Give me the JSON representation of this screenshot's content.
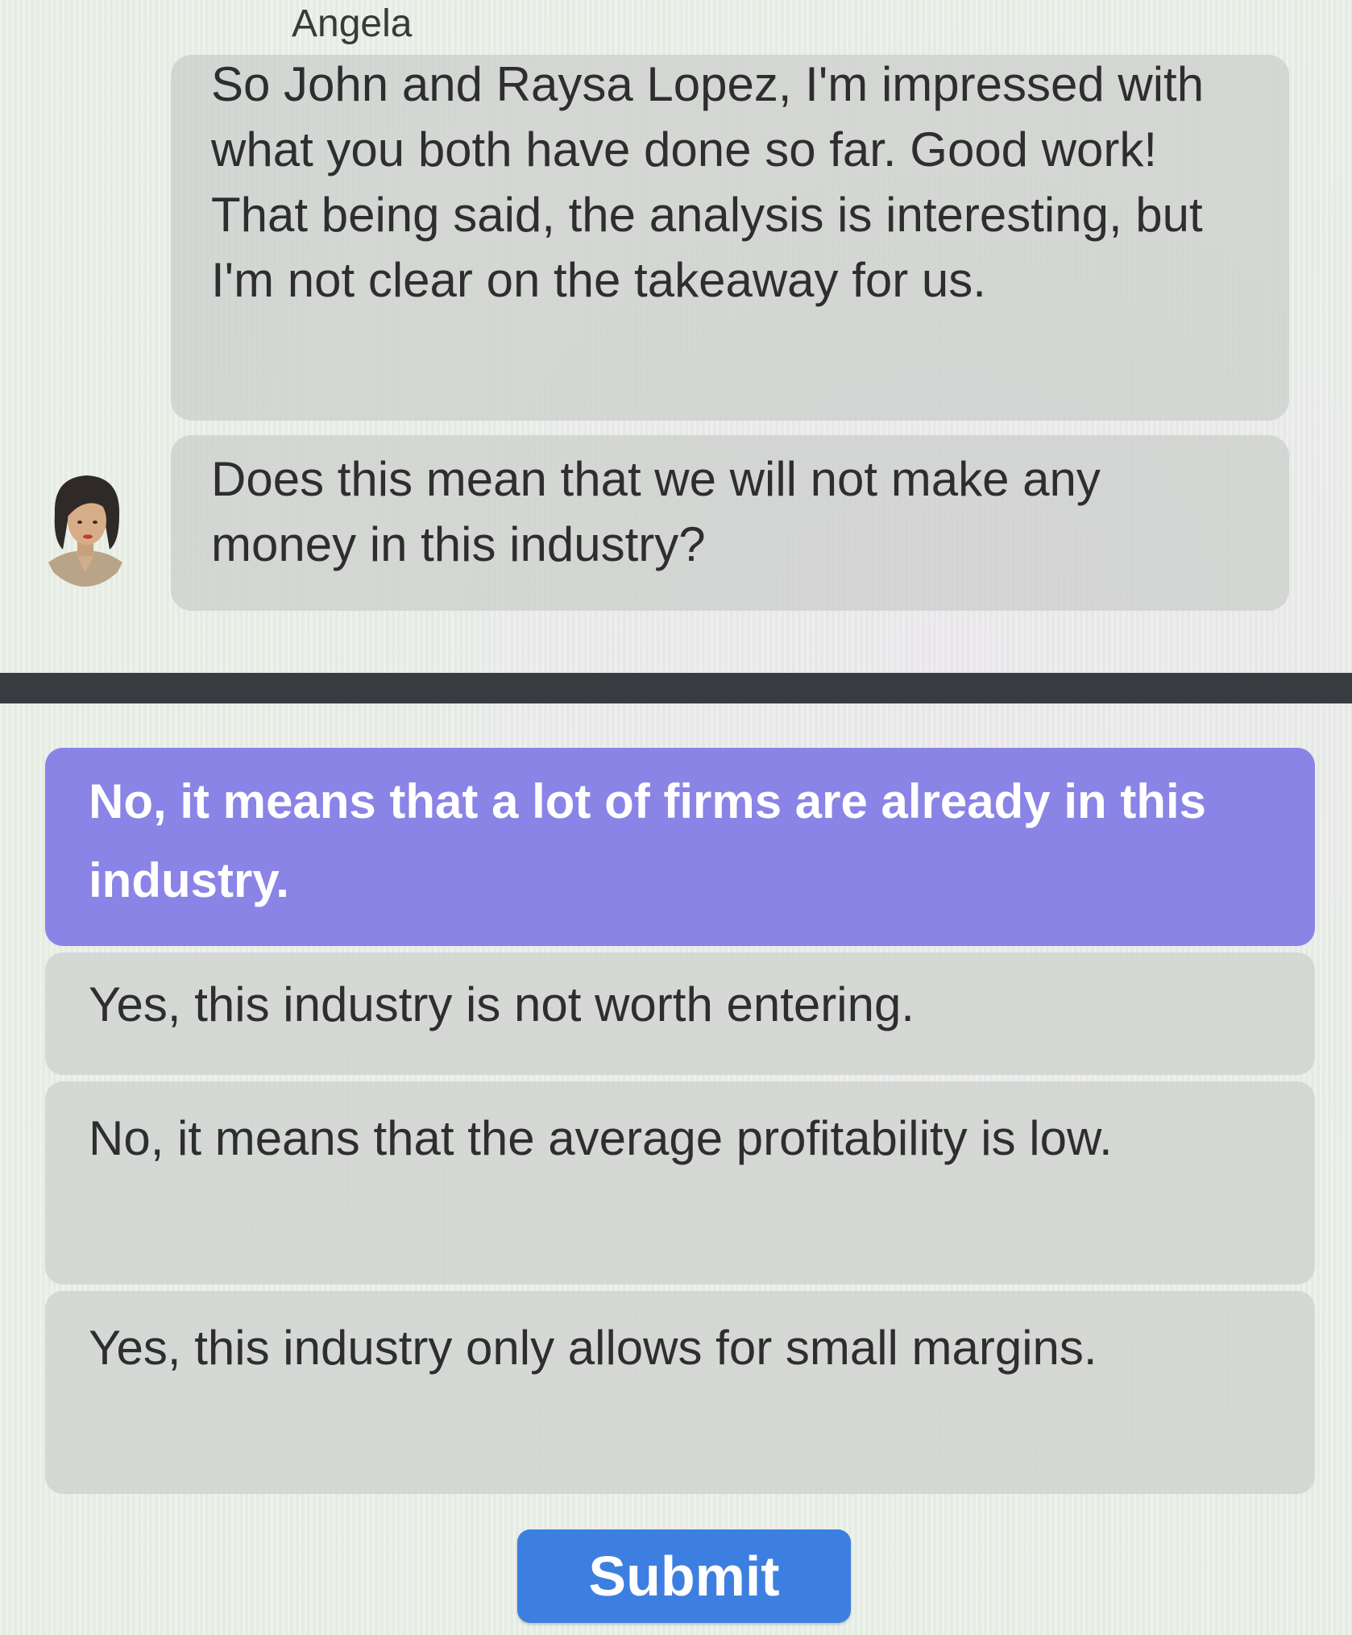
{
  "speaker": {
    "name": "Angela",
    "avatar_icon": "woman-avatar-icon"
  },
  "messages": [
    {
      "text": "So John and Raysa Lopez, I'm impressed with what you both have done so far. Good work! That being said, the analysis is interesting, but I'm not clear on the takeaway for us."
    },
    {
      "text": "Does this mean that we will not make any money in this industry?"
    }
  ],
  "options": [
    {
      "label": "No, it means that a lot of firms are already in this industry.",
      "selected": true
    },
    {
      "label": "Yes, this industry is not worth entering.",
      "selected": false
    },
    {
      "label": "No, it means that the average profitability is low.",
      "selected": false
    },
    {
      "label": "Yes, this industry only allows for small margins.",
      "selected": false
    }
  ],
  "submit_label": "Submit",
  "colors": {
    "selected_option": "#8a84e6",
    "submit_button": "#3d7fe0",
    "divider": "#383c40"
  }
}
